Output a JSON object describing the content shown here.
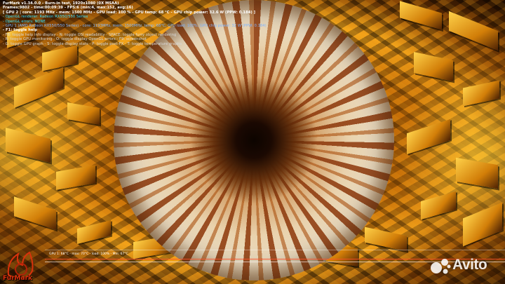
{
  "app": {
    "name": "FurMark"
  },
  "hud": {
    "lines": [
      {
        "text": "FurMark v1.34.0.0 - Burn-in test, 1920x1080 (0X MSAA)",
        "color": "white"
      },
      {
        "text": "Frames:9802 - time:00:09:39 - FPS:6 (min:4, max:152, avg:16)",
        "color": "white"
      },
      {
        "text": "[ GPU 2 | core: 1193 MHz - mem: 1500 MHz - GPU load: 100 % - GPU temp: 68 °C - GPU chip power: 32.6 W (PPW: 0.184) ]",
        "color": "white"
      },
      {
        "text": "- OpenGL renderer: Radeon RX550/550 Series",
        "color": "cyan"
      },
      {
        "text": "- OpenGL errors: NONE",
        "color": "cyan"
      },
      {
        "text": "- GPU 1 (AMD Radeon RX550/550 Series) - core: 1193MHz, mem: 1500MHz, temp: 68°C, GPU load: 100%, GPU chip power: 32 W (PPW: 0.184)",
        "color": "blue"
      },
      {
        "text": "- F1: toggle help",
        "color": "white"
      },
      {
        "text": "- F8: toggle help info display - N: toggle OSI readability - SPACE: toggle furry object rendering",
        "color": "grey"
      },
      {
        "text": "- R: toggle GPU monitoring - O: toggle display OpenGL errors - F9: screenshot",
        "color": "grey"
      },
      {
        "text": "- G: toggle GPU graph - S: toggle display stats - P: toggle post-FX - T: toggle temperature graphs",
        "color": "grey"
      }
    ]
  },
  "graph": {
    "label": "GPU 1: 68°C - max: 70°C - load: 100% - Min: 67°C"
  },
  "logo": {
    "text": "FurMark"
  },
  "watermark": {
    "text": "Avito"
  }
}
